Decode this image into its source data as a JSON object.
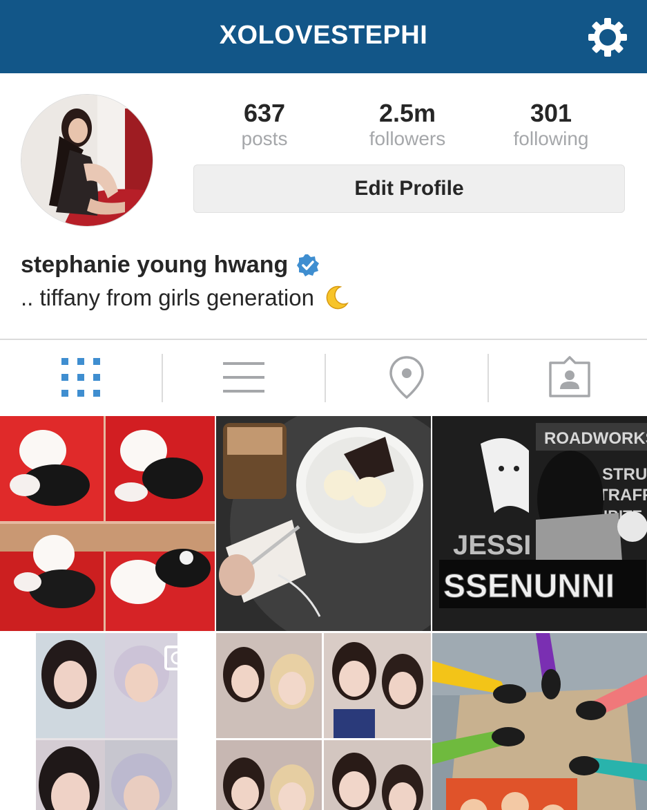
{
  "header": {
    "username": "XOLOVESTEPHI",
    "settings_icon": "gear-icon"
  },
  "colors": {
    "header_bg": "#125688",
    "active_tab": "#3f8ed0",
    "inactive_tab": "#a5a7aa",
    "verified": "#3897f0"
  },
  "stats": {
    "posts": {
      "value": "637",
      "label": "posts"
    },
    "followers": {
      "value": "2.5m",
      "label": "followers"
    },
    "following": {
      "value": "301",
      "label": "following"
    }
  },
  "edit_profile_label": "Edit Profile",
  "profile": {
    "name": "stephanie young hwang",
    "bio": ".. tiffany from girls generation"
  },
  "tabs": [
    {
      "icon": "grid-icon",
      "active": true
    },
    {
      "icon": "list-icon",
      "active": false
    },
    {
      "icon": "location-pin-icon",
      "active": false
    },
    {
      "icon": "tagged-photos-icon",
      "active": false
    }
  ],
  "photos": {
    "top_right_sign": "ROADWORKS",
    "top_right_lines": [
      "STRUCT",
      "TRAFFIC",
      "IBITE"
    ],
    "top_right_caption_1": "JESSI",
    "top_right_caption_2": "SSENUNNI"
  }
}
